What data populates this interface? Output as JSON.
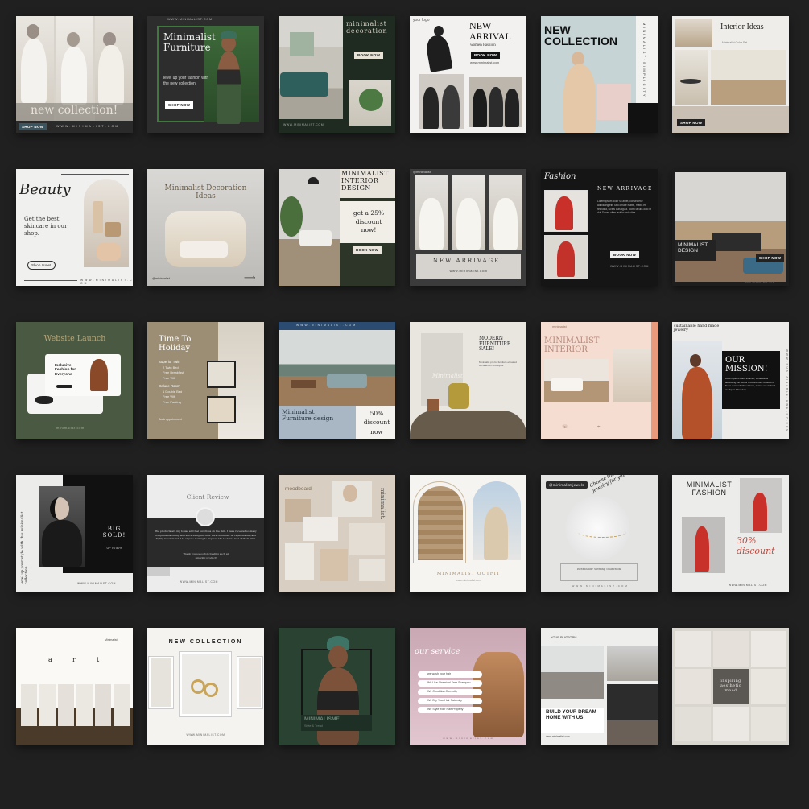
{
  "colors": {
    "background": "#202020",
    "sage": "#4a5a42",
    "cream": "#efe9df",
    "peach": "#f6ddd1",
    "taupe": "#9c8e74",
    "forest": "#2a4232"
  },
  "cards": [
    {
      "caption": "new collection!",
      "button": "SHOP NOW",
      "footer": "W W W . M I N I M A L I S T . C O M"
    },
    {
      "title": "Minimalist Furniture",
      "body": "level up your fashion with the new collection!",
      "button": "SHOP NOW",
      "top": "WWW.MINIMALIST.COM"
    },
    {
      "title": "minimalist decoration",
      "button": "BOOK NOW",
      "footer": "WWW.MINIMALIST.COM"
    },
    {
      "logo": "your logo",
      "title": "NEW ARRIVAL",
      "subtitle": "women Fashion",
      "button": "BOOK NOW",
      "url": "www.minimalist.com"
    },
    {
      "title": "NEW COLLECTION",
      "side": "M I N I M A L I S T  ·  S I M P L I C I T Y"
    },
    {
      "title": "Interior Ideas",
      "subtitle": "Minimalist Color Set",
      "button": "SHOP NOW"
    },
    {
      "title": "Beauty",
      "body": "Get the best skincare in our shop.",
      "button": "Shop Now!",
      "footer": "W W W . M I N I M A L I S T . C O M"
    },
    {
      "title": "Minimalist Decoration Ideas",
      "handle": "@minimalist"
    },
    {
      "title": "MINIMALIST INTERIOR DESIGN",
      "body": "get a 25% discount now!",
      "button": "BOOK NOW"
    },
    {
      "handle": "@minimalist",
      "title": "NEW ARRIVAGE!",
      "url": "www.minimalist.com"
    },
    {
      "script": "Fashion",
      "title": "NEW ARRIVAGE",
      "body": "Lorem ipsum dolor sit amet, consectetur adipiscing elit. Sed ornare mattis, mattis et finibus a, luctus quis ligula. Morbi iaculis odio et dui. Donec vitae lacinia sed, vitae.",
      "button": "BOOK NOW",
      "url": "WWW.MINIMALIST.COM"
    },
    {
      "title": "MINIMALIST DESIGN",
      "button": "SHOP NOW",
      "url": "www.minimalist.com"
    },
    {
      "title": "Website Launch",
      "popup": "Inclusive Fashion for Everyone",
      "url": "minimalist.com"
    },
    {
      "title": "Time To Holiday",
      "items": [
        "Superior Twin",
        "2 Twin Bed",
        "Free Breakfast",
        "Free Wifi",
        "Deluxe Room",
        "1 Double Bed",
        "Free Wifi",
        "Free Parking"
      ],
      "footer": "Book appointment"
    },
    {
      "top": "W W W . M I N I M A L I S T . C O M",
      "title": "Minimalist Furniture design",
      "discount": "50% discount now"
    },
    {
      "title": "MODERN FURNITURE SALE!",
      "body": "Minimalist pro for furniture elevated of collection and styles.",
      "art": "Minimalist"
    },
    {
      "brand": "minimalist",
      "title": "MINIMALIST INTERIOR"
    },
    {
      "brand": "sustainable hand made jewelry",
      "title": "OUR MISSION!",
      "body": "Lorem ipsum dolor sit amet, consectetur adipiscing elit. Morbi tincidunt nunc ut dictum. Nunc euismod nibh ultrices, cursus mi eleifend at aliquet bibendum.",
      "side": "W W W . S U S T A I N A B L E J E W E L R Y . C O M"
    },
    {
      "side": "level up your style with this minimalist collection",
      "title": "BIG SOLD!",
      "sub": "UP TO 80%",
      "url": "WWW.MINIMALIST.COM"
    },
    {
      "title": "Client Review",
      "body": "The products are my to use and feel luxurious on the skin. I have received so many compliments on my skin since using this line. I will definitely be repurchasing and highly recommend it to anyone looking to improve the look and feel of their skin!",
      "thanks": "Thank you soooo for creating such an amazing product!",
      "url": "WWW.MINIMALIST.COM"
    },
    {
      "title": "moodboard",
      "side": "minimalist."
    },
    {
      "caption": "MINIMALIST OUTFIT",
      "url": "www.minimalist.com"
    },
    {
      "handle": "@minimalist.jewels",
      "script": "Choose the right jewelry for you",
      "caption": "Best in our sterling collection",
      "url": "W W W . M I N I M A L I S T . C O M"
    },
    {
      "title": "MINIMALIST FASHION",
      "script": "30% discount",
      "url": "WWW.MINIMALIST.COM"
    },
    {
      "letters": [
        "a",
        "r",
        "t"
      ],
      "top": "Minimalist"
    },
    {
      "title": "NEW COLLECTION",
      "url": "WWW.MINIMALIST.COM"
    },
    {
      "title": "MINIMALISME",
      "sub": "Style & Trend"
    },
    {
      "title": "our service",
      "items": [
        "we wash your hair",
        "We Use Chemical Free Shampoo",
        "We Condition Correctly",
        "We Dry Your Hair Naturally",
        "We Style Your Hair Properly"
      ],
      "url": "w w w . m i n i m a l i s t . c o m"
    },
    {
      "brand": "YOUR PLATFORM",
      "title": "BUILD YOUR DREAM HOME WITH US",
      "url": "www.minimalist.com"
    },
    {
      "body": "inspiring aesthetic mood"
    }
  ]
}
